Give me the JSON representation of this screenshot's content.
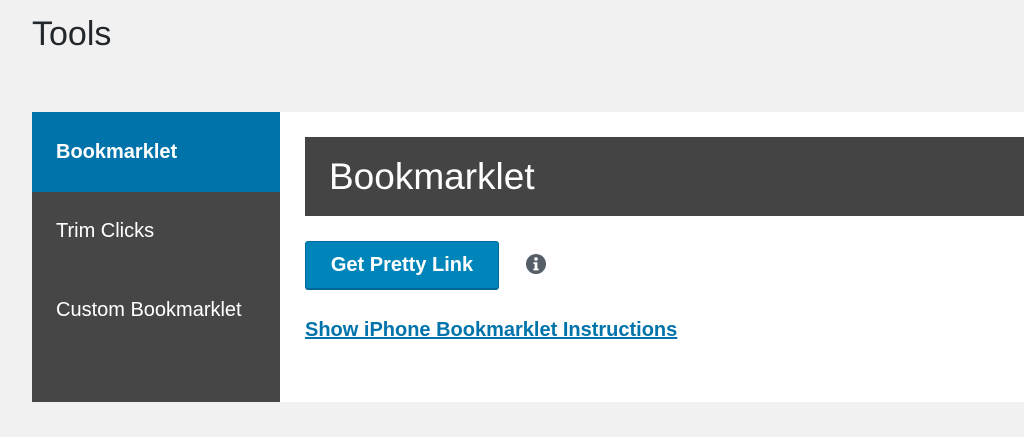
{
  "page": {
    "title": "Tools"
  },
  "sidebar": {
    "items": [
      {
        "label": "Bookmarklet",
        "active": true
      },
      {
        "label": "Trim Clicks",
        "active": false
      },
      {
        "label": "Custom Bookmarklet",
        "active": false
      }
    ]
  },
  "main": {
    "section_title": "Bookmarklet",
    "get_link_button": "Get Pretty Link",
    "info_icon": "info-circle-icon",
    "iphone_link": "Show iPhone Bookmarklet Instructions"
  },
  "colors": {
    "page_background": "#f1f1f1",
    "sidebar_background": "#464646",
    "active_item": "#0073aa",
    "header_background": "#444444",
    "button": "#0085ba",
    "link": "#0073aa"
  }
}
